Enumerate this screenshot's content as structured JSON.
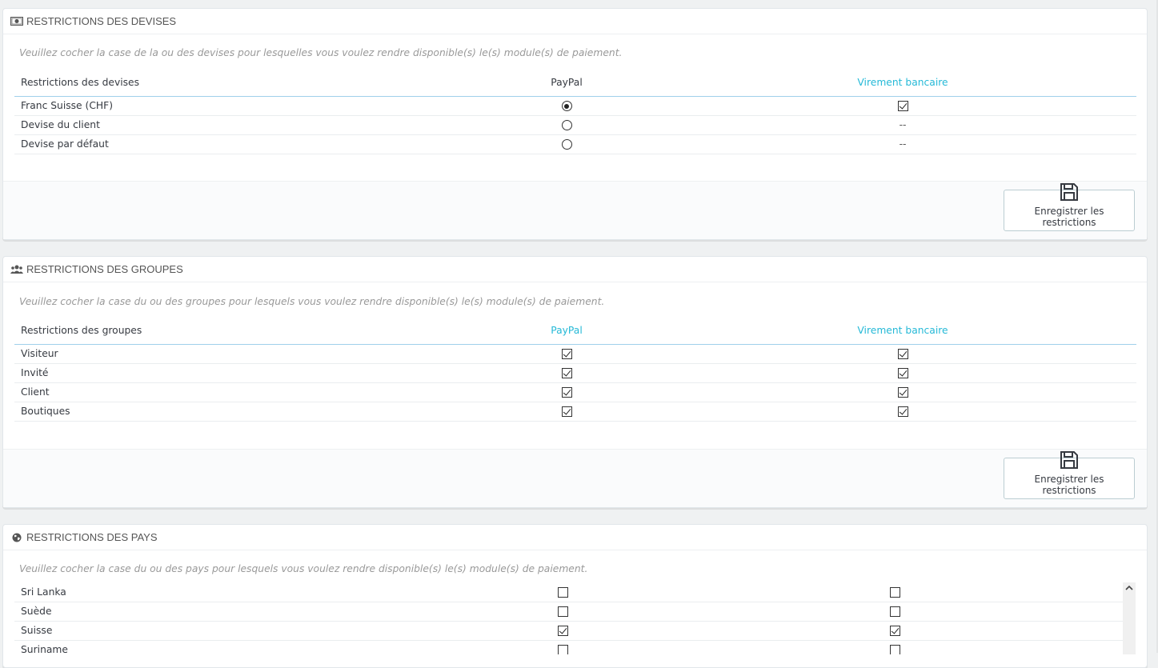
{
  "currency": {
    "heading": "RESTRICTIONS DES DEVISES",
    "help": "Veuillez cocher la case de la ou des devises pour lesquelles vous voulez rendre disponible(s) le(s) module(s) de paiement.",
    "col_label": "Restrictions des devises",
    "col_paypal": "PayPal",
    "col_virement": "Virement bancaire",
    "rows": [
      {
        "label": "Franc Suisse (CHF)",
        "paypal": "radio-on",
        "virement": "check-on"
      },
      {
        "label": "Devise du client",
        "paypal": "radio-off",
        "virement": "--"
      },
      {
        "label": "Devise par défaut",
        "paypal": "radio-off",
        "virement": "--"
      }
    ],
    "save_label": "Enregistrer les restrictions"
  },
  "groups": {
    "heading": "RESTRICTIONS DES GROUPES",
    "help": "Veuillez cocher la case du ou des groupes pour lesquels vous voulez rendre disponible(s) le(s) module(s) de paiement.",
    "col_label": "Restrictions des groupes",
    "col_paypal": "PayPal",
    "col_virement": "Virement bancaire",
    "rows": [
      {
        "label": "Visiteur",
        "paypal": "check-on",
        "virement": "check-on"
      },
      {
        "label": "Invité",
        "paypal": "check-on",
        "virement": "check-on"
      },
      {
        "label": "Client",
        "paypal": "check-on",
        "virement": "check-on"
      },
      {
        "label": "Boutiques",
        "paypal": "check-on",
        "virement": "check-on"
      }
    ],
    "save_label": "Enregistrer les restrictions"
  },
  "countries": {
    "heading": "RESTRICTIONS DES PAYS",
    "help": "Veuillez cocher la case du ou des pays pour lesquels vous voulez rendre disponible(s) le(s) module(s) de paiement.",
    "rows": [
      {
        "label": "Sri Lanka",
        "paypal": "check-off",
        "virement": "check-off"
      },
      {
        "label": "Suède",
        "paypal": "check-off",
        "virement": "check-off"
      },
      {
        "label": "Suisse",
        "paypal": "check-on",
        "virement": "check-on"
      },
      {
        "label": "Suriname",
        "paypal": "check-off",
        "virement": "check-off"
      }
    ]
  },
  "icons": {
    "currency": "money-icon",
    "groups": "users-icon",
    "countries": "globe-icon",
    "save": "floppy-disk-icon",
    "scroll_up": "chevron-up-icon"
  },
  "colors": {
    "link": "#25b9d7",
    "header_border": "#a0d0eb",
    "help_text": "#999999"
  }
}
